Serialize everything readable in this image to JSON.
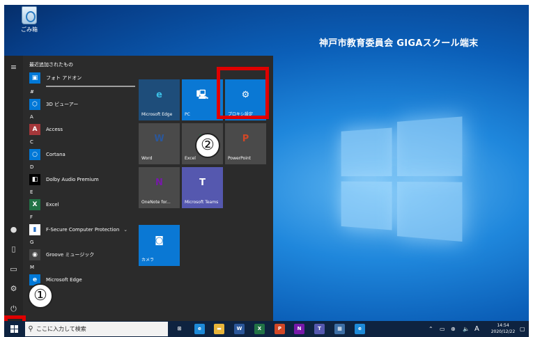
{
  "desktop": {
    "recycle_bin_label": "ごみ箱",
    "title": "神戸市教育委員会 GIGAスクール端末"
  },
  "start_menu": {
    "recent_header": "最近追加されたもの",
    "apps": [
      {
        "type": "app",
        "label": "フォト アドオン",
        "icon": "photo-addon-icon",
        "color": "#0078d7",
        "glyph": "▣"
      },
      {
        "type": "letter",
        "label": "#"
      },
      {
        "type": "app",
        "label": "3D ビューアー",
        "icon": "3d-viewer-icon",
        "color": "#0078d7",
        "glyph": "⬡"
      },
      {
        "type": "letter",
        "label": "A"
      },
      {
        "type": "app",
        "label": "Access",
        "icon": "access-icon",
        "color": "#a4373a",
        "glyph": "A"
      },
      {
        "type": "letter",
        "label": "C"
      },
      {
        "type": "app",
        "label": "Cortana",
        "icon": "cortana-icon",
        "color": "#0078d7",
        "glyph": "○"
      },
      {
        "type": "letter",
        "label": "D"
      },
      {
        "type": "app",
        "label": "Dolby Audio Premium",
        "icon": "dolby-icon",
        "color": "#000000",
        "glyph": "◧"
      },
      {
        "type": "letter",
        "label": "E"
      },
      {
        "type": "app",
        "label": "Excel",
        "icon": "excel-icon",
        "color": "#217346",
        "glyph": "X"
      },
      {
        "type": "letter",
        "label": "F"
      },
      {
        "type": "app",
        "label": "F-Secure Computer Protection",
        "icon": "f-secure-icon",
        "color": "#ffffff",
        "glyph": "▮",
        "expandable": true
      },
      {
        "type": "letter",
        "label": "G"
      },
      {
        "type": "app",
        "label": "Groove ミュージック",
        "icon": "groove-music-icon",
        "color": "#444444",
        "glyph": "◉"
      },
      {
        "type": "letter",
        "label": "M"
      },
      {
        "type": "app",
        "label": "Microsoft Edge",
        "icon": "edge-icon",
        "color": "#0078d7",
        "glyph": "e"
      }
    ],
    "tiles": [
      {
        "label": "Microsoft Edge",
        "icon": "edge-icon",
        "glyph": "e",
        "color": "#1e4d7a",
        "icon_color": "#3bbfe6"
      },
      {
        "label": "PC",
        "icon": "pc-icon",
        "glyph": "🖳",
        "color": "#0a78d4",
        "icon_color": "#ffffff"
      },
      {
        "label": "プロキシ設定",
        "icon": "gear-icon",
        "glyph": "⚙",
        "color": "#0a78d4",
        "icon_color": "#ffffff"
      },
      {
        "label": "Word",
        "icon": "word-icon",
        "glyph": "W",
        "color": "#4a4a4a",
        "icon_color": "#2b579a"
      },
      {
        "label": "Excel",
        "icon": "excel-icon",
        "glyph": "X",
        "color": "#4a4a4a",
        "icon_color": "#217346"
      },
      {
        "label": "PowerPoint",
        "icon": "powerpoint-icon",
        "glyph": "P",
        "color": "#4a4a4a",
        "icon_color": "#d24726"
      },
      {
        "label": "OneNote for...",
        "icon": "onenote-icon",
        "glyph": "N",
        "color": "#4a4a4a",
        "icon_color": "#7719aa"
      },
      {
        "label": "Microsoft Teams",
        "icon": "teams-icon",
        "glyph": "T",
        "color": "#5558af",
        "icon_color": "#ffffff"
      },
      {
        "label": "カメラ",
        "icon": "camera-icon",
        "glyph": "◙",
        "color": "#0a78d4",
        "icon_color": "#ffffff"
      }
    ]
  },
  "annotations": {
    "step1": "①",
    "step2": "②",
    "highlight_color": "#e00000"
  },
  "taskbar": {
    "search_placeholder": "ここに入力して検索",
    "pinned": [
      {
        "icon": "task-view-icon",
        "glyph": "⊞",
        "color": "transparent"
      },
      {
        "icon": "edge-icon",
        "glyph": "e",
        "color": "#1d8ad8"
      },
      {
        "icon": "file-explorer-icon",
        "glyph": "▬",
        "color": "#e8b53a"
      },
      {
        "icon": "word-icon",
        "glyph": "W",
        "color": "#2b579a"
      },
      {
        "icon": "excel-icon",
        "glyph": "X",
        "color": "#217346"
      },
      {
        "icon": "powerpoint-icon",
        "glyph": "P",
        "color": "#d24726"
      },
      {
        "icon": "onenote-icon",
        "glyph": "N",
        "color": "#7719aa"
      },
      {
        "icon": "teams-icon",
        "glyph": "T",
        "color": "#5558af"
      },
      {
        "icon": "photos-icon",
        "glyph": "▦",
        "color": "#3d6fa6"
      },
      {
        "icon": "edge-icon",
        "glyph": "e",
        "color": "#1d8ad8"
      }
    ],
    "ime": "A",
    "time": "14:54",
    "date": "2020/12/22"
  }
}
